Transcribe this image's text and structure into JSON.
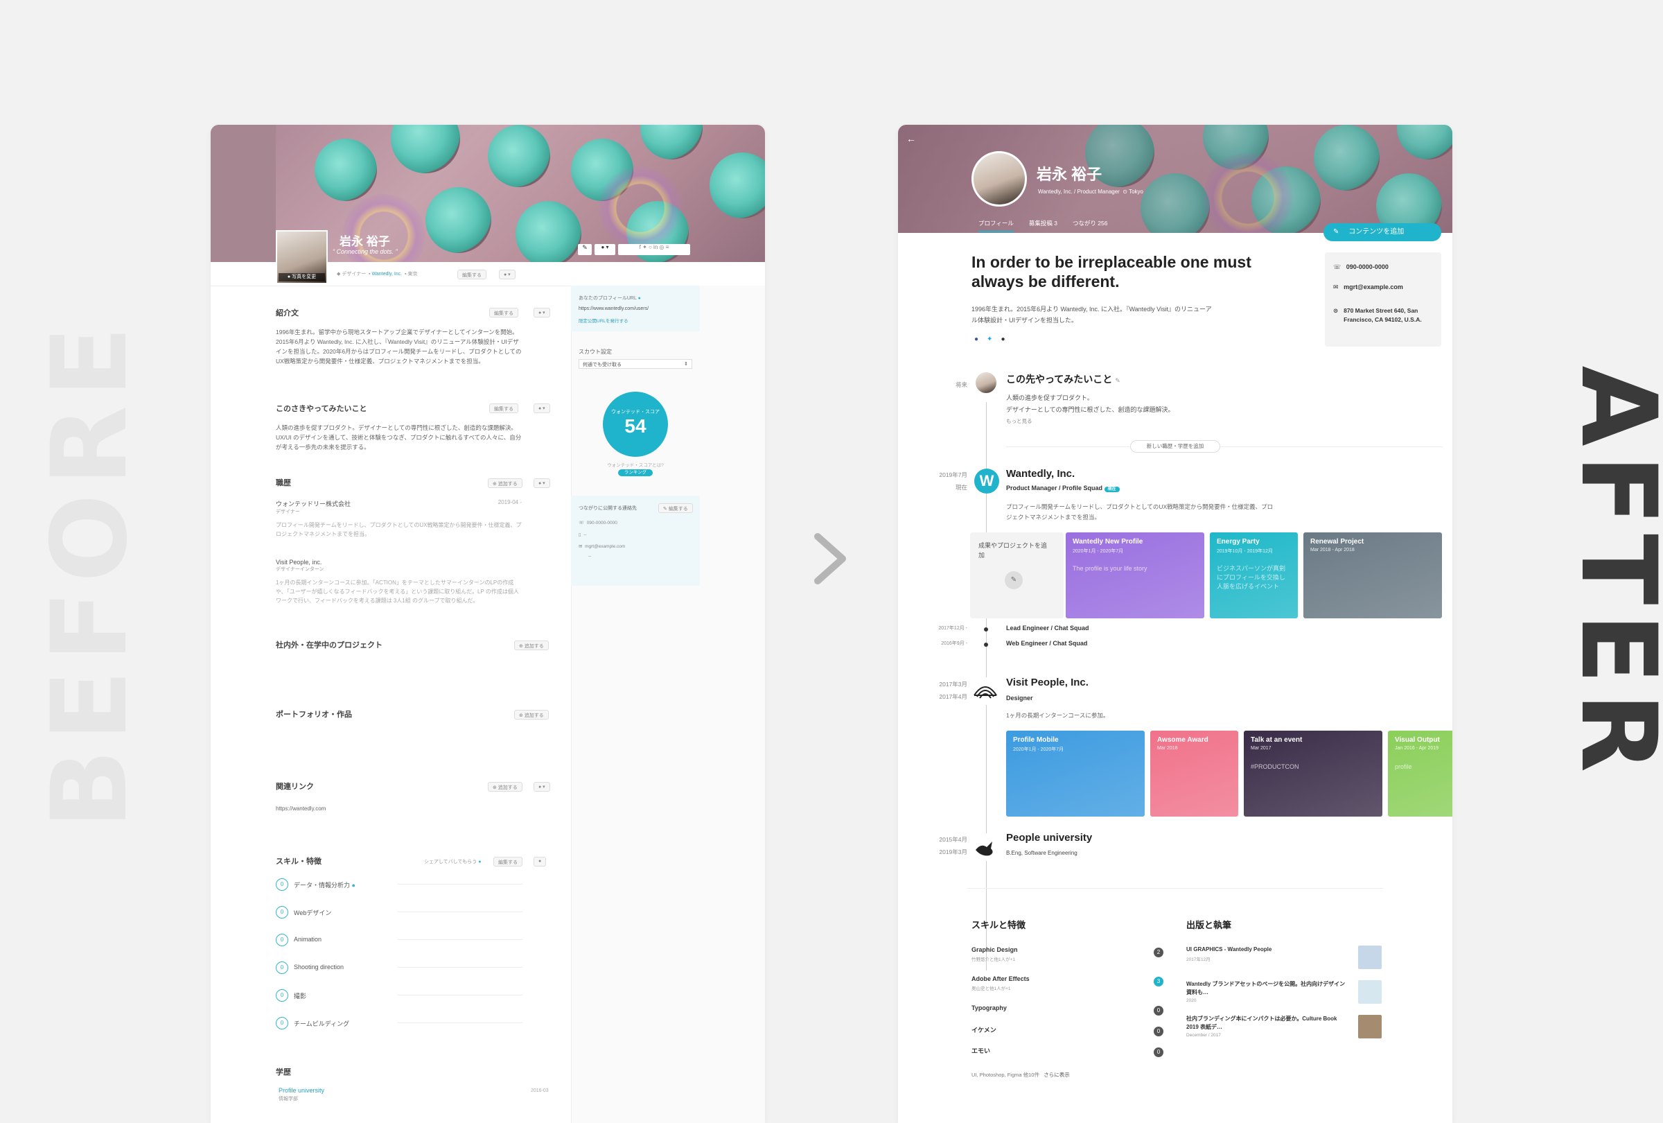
{
  "labels": {
    "before": "BEFORE",
    "after": "AFTER"
  },
  "before": {
    "name": "岩永 裕子",
    "tagline": "Connecting the dots.",
    "photo_change": "写真を変更",
    "meta": {
      "role": "デザイナー",
      "company": "Wantedly, Inc.",
      "location": "東京",
      "edit": "編集する"
    },
    "intro": {
      "heading": "紹介文",
      "edit": "編集する",
      "text": "1996年生まれ。留学中から現地スタートアップ企業でデザイナーとしてインターンを開始。2015年6月より Wantedly, Inc. に入社し、『Wantedly Visit』のリニューアル体験設計・UIデザインを担当した。2020年6月からはプロフィール開発チームをリードし、プロダクトとしてのUX戦略策定から開発要件・仕様定義、プロジェクトマネジメントまでを担当。"
    },
    "future": {
      "heading": "このさきやってみたいこと",
      "edit": "編集する",
      "text": "人類の進歩を促すプロダクト。デザイナーとしての専門性に根ざした、創造的な課題解決。UX/UI のデザインを通して、技術と体験をつなぎ、プロダクトに触れるすべての人々に、自分が考える一歩先の未来を提示する。"
    },
    "career": {
      "heading": "職歴",
      "add": "追加する",
      "items": [
        {
          "company": "ウォンテッドリー株式会社",
          "role": "デザイナー",
          "date": "2019-04 -",
          "text": "プロフィール開発チームをリードし、プロダクトとしてのUX戦略策定から開発要件・仕様定義、プロジェクトマネジメントまでを担当。"
        },
        {
          "company": "Visit People, inc.",
          "role": "デザイナーインターン",
          "date": "",
          "text": "1ヶ月の長期インターンコースに参加。「ACTION」をテーマとしたサマーインターンのLPの作成や、「ユーザーが嬉しくなるフィードバックを考える」という課題に取り組んだ。LP の作成は個人ワークで行い、フィードバックを考える課題は 3人1組 のグループで取り組んだ。"
        }
      ]
    },
    "projects": {
      "heading": "社内外・在学中のプロジェクト",
      "add": "追加する"
    },
    "portfolio": {
      "heading": "ポートフォリオ・作品",
      "add": "追加する"
    },
    "links": {
      "heading": "関連リンク",
      "add": "追加する",
      "url": "https://wantedly.com"
    },
    "skills": {
      "heading": "スキル・特徴",
      "share": "シェアしてバしてもらう",
      "edit": "編集する",
      "items": [
        {
          "count": "0",
          "name": "データ・情報分析力"
        },
        {
          "count": "0",
          "name": "Webデザイン"
        },
        {
          "count": "0",
          "name": "Animation"
        },
        {
          "count": "0",
          "name": "Shooting direction"
        },
        {
          "count": "0",
          "name": "撮影"
        },
        {
          "count": "0",
          "name": "チームビルディング"
        }
      ]
    },
    "education": {
      "heading": "学歴",
      "school": "Profile university",
      "dept": "情報学部",
      "date": "2016-03"
    },
    "sidebar": {
      "profile_url_label": "あなたのプロフィールURL",
      "profile_url": "https://www.wantedly.com/users/",
      "url_publish": "限定公開URLを発行する",
      "scout_label": "スカウト設定",
      "scout_value": "何通でも受け取る",
      "score_label": "ウォンテッド・スコア",
      "score": "54",
      "score_help": "ウォンテッド・スコアとは?",
      "ranking": "ランキング",
      "contact_label": "つながりに公開する連絡先",
      "contact_edit": "編集する",
      "phone": "090-0000-0000",
      "dash1": "--",
      "email": "mgrt@example.com",
      "dash2": "--"
    }
  },
  "after": {
    "name": "岩永 裕子",
    "subtitle": "Wantedly, Inc. / Product Manager",
    "location": "Tokyo",
    "tabs": [
      "プロフィール",
      "募集投稿 3",
      "つながり 256"
    ],
    "add_content": "コンテンツを追加",
    "headline": "In order to be irreplaceable one must always be different.",
    "bio": "1996年生まれ。2015年6月より Wantedly, Inc. に入社。『Wantedly Visit』のリニューアル体験設計・UIデザインを担当した。",
    "contact": {
      "phone": "090-0000-0000",
      "email": "mgrt@example.com",
      "address": "870 Market Street 640, San Francisco, CA 94102, U.S.A."
    },
    "future": {
      "label": "将来",
      "title": "この先やってみたいこと",
      "line1": "人類の進歩を促すプロダクト。",
      "line2": "デザイナーとしての専門性に根ざした、創造的な課題解決。",
      "more": "もっと見る"
    },
    "add_career": "新しい職歴・学歴を追加",
    "jobs": [
      {
        "date1": "2019年7月",
        "date2": "現在",
        "company": "Wantedly, Inc.",
        "role": "Product Manager / Profile Squad",
        "badge": "現在",
        "desc": "プロフィール開発チームをリードし、プロダクトとしてのUX戦略策定から開発要件・仕様定義、プロジェクトマネジメントまでを担当。"
      },
      {
        "date1": "2017年3月",
        "date2": "2017年4月",
        "company": "Visit People, Inc.",
        "role": "Designer",
        "desc": "1ヶ月の長期インターンコースに参加。"
      },
      {
        "date1": "2015年4月",
        "date2": "2019年3月",
        "company": "People university",
        "role": "B.Eng, Software Engineering",
        "desc": ""
      }
    ],
    "sub_roles": [
      {
        "date": "2017年12月 -",
        "title": "Lead Engineer / Chat Squad"
      },
      {
        "date": "2016年9月 -",
        "title": "Web Engineer / Chat Squad"
      }
    ],
    "add_project": "成果やプロジェクトを追加",
    "tiles_row1": [
      {
        "title": "Wantedly New Profile",
        "sub": "2020年1月 - 2020年7月",
        "color": "#9a6fe0",
        "overlay": "The profile is your life story"
      },
      {
        "title": "Energy Party",
        "sub": "2019年10月 - 2019年12月",
        "color": "#1fb8c9",
        "overlay": "ビジネスパーソンが真剣にプロフィールを交換し人脈を広げるイベント"
      },
      {
        "title": "Renewal Project",
        "sub": "Mar 2018 - Apr 2018",
        "color": "#6a7a85",
        "overlay": ""
      }
    ],
    "tiles_row2": [
      {
        "title": "Profile Mobile",
        "sub": "2020年1月 - 2020年7月",
        "color": "#3c9be0",
        "overlay": ""
      },
      {
        "title": "Awsome Award",
        "sub": "Mar 2018",
        "color": "#f0728a",
        "overlay": ""
      },
      {
        "title": "Talk at an event",
        "sub": "Mar 2017",
        "color": "#3a2c48",
        "overlay": "#PRODUCTCON"
      },
      {
        "title": "Visual Output",
        "sub": "Jan 2016 - Apr 2019",
        "color": "#8bcf5a",
        "overlay": "profile"
      }
    ],
    "skills": {
      "heading": "スキルと特徴",
      "items": [
        {
          "name": "Graphic Design",
          "endorsers": "竹野悠介と他1人が+1",
          "count": "2"
        },
        {
          "name": "Adobe After Effects",
          "endorsers": "奥山史と他1人が+1",
          "count": "3"
        },
        {
          "name": "Typography",
          "endorsers": "",
          "count": "0"
        },
        {
          "name": "イケメン",
          "endorsers": "",
          "count": "0"
        },
        {
          "name": "エモい",
          "endorsers": "",
          "count": "0"
        }
      ],
      "more_list": "UI, Photoshop, Figma 他10件",
      "more": "さらに表示"
    },
    "publications": {
      "heading": "出版と執筆",
      "items": [
        {
          "title": "UI GRAPHICS - Wantedly People",
          "date": "2017年12月"
        },
        {
          "title": "Wantedly ブランドアセットのページを公開。社内向けデザイン資料も…",
          "date": "2020"
        },
        {
          "title": "社内ブランディング本にインパクトは必要か。Culture Book 2019 表紙デ…",
          "date": "December / 2017"
        }
      ]
    }
  },
  "colors": {
    "accent": "#1fb3cc",
    "background": "#f2f2f2"
  }
}
